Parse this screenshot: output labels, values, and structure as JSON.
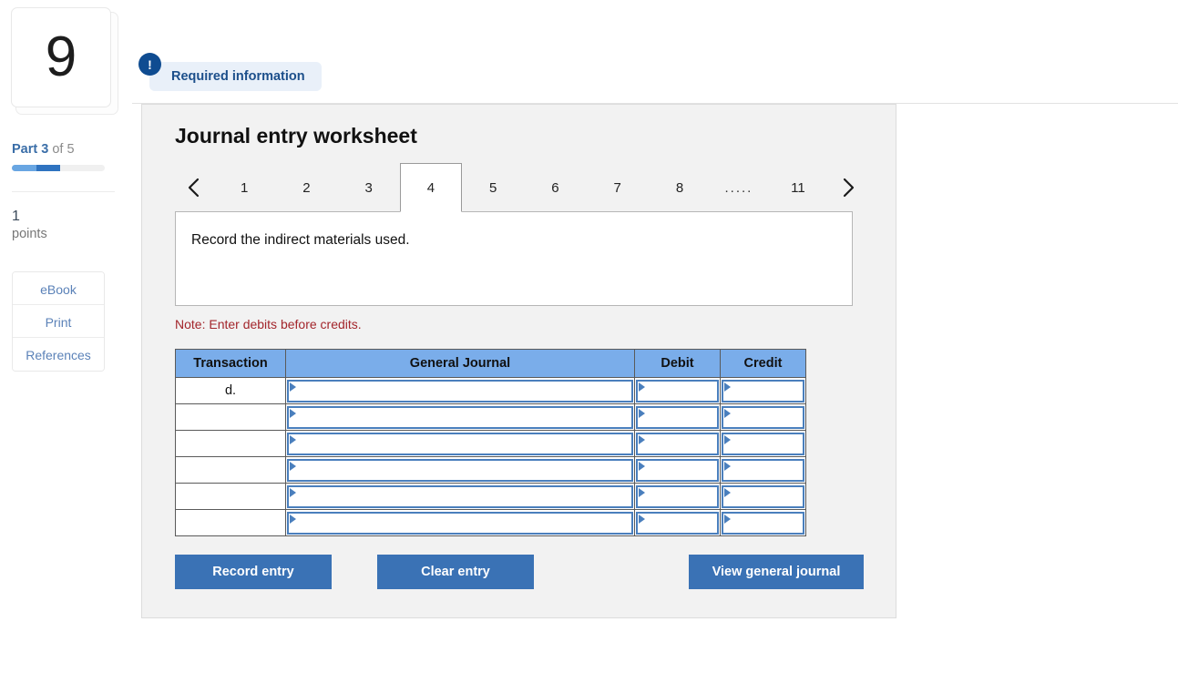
{
  "sidebar": {
    "question_number": "9",
    "part_prefix": "Part",
    "part_current": "3",
    "part_suffix": "of 5",
    "points_value": "1",
    "points_label": "points",
    "buttons": [
      {
        "label": "eBook",
        "name": "ebook-button"
      },
      {
        "label": "Print",
        "name": "print-button"
      },
      {
        "label": "References",
        "name": "references-button"
      }
    ],
    "progress_percent": 52,
    "progress_color_light": "#69a6e2",
    "progress_color_dark": "#2f73c0"
  },
  "badge": {
    "icon": "exclamation-icon",
    "icon_glyph": "!",
    "label": "Required information",
    "background": "#e9f0f9",
    "text_color": "#1c4f8b",
    "icon_background": "#0f4c91"
  },
  "panel": {
    "title": "Journal entry worksheet",
    "prompt": "Record the indirect materials used.",
    "note": "Note: Enter debits before credits.",
    "note_color": "#a3262c"
  },
  "tabs": {
    "prev_icon": "chevron-left-icon",
    "next_icon": "chevron-right-icon",
    "items": [
      {
        "label": "1",
        "active": false
      },
      {
        "label": "2",
        "active": false
      },
      {
        "label": "3",
        "active": false
      },
      {
        "label": "4",
        "active": true
      },
      {
        "label": "5",
        "active": false
      },
      {
        "label": "6",
        "active": false
      },
      {
        "label": "7",
        "active": false
      },
      {
        "label": "8",
        "active": false
      },
      {
        "label": ".....",
        "active": false,
        "dots": true
      },
      {
        "label": "11",
        "active": false
      }
    ]
  },
  "table": {
    "header_background": "#7aadea",
    "columns": [
      "Transaction",
      "General Journal",
      "Debit",
      "Credit"
    ],
    "rows": [
      {
        "transaction": "d.",
        "general_journal": "",
        "debit": "",
        "credit": ""
      },
      {
        "transaction": "",
        "general_journal": "",
        "debit": "",
        "credit": ""
      },
      {
        "transaction": "",
        "general_journal": "",
        "debit": "",
        "credit": ""
      },
      {
        "transaction": "",
        "general_journal": "",
        "debit": "",
        "credit": ""
      },
      {
        "transaction": "",
        "general_journal": "",
        "debit": "",
        "credit": ""
      },
      {
        "transaction": "",
        "general_journal": "",
        "debit": "",
        "credit": ""
      }
    ]
  },
  "actions": {
    "record_label": "Record entry",
    "clear_label": "Clear entry",
    "view_label": "View general journal",
    "button_color": "#3a72b5"
  }
}
